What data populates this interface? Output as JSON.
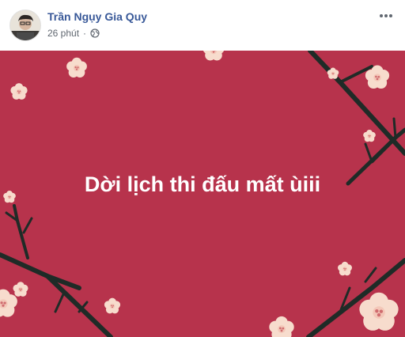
{
  "post": {
    "author": "Trần Ngụy Gia Quy",
    "timestamp": "26 phút",
    "separator": "·",
    "privacy_icon": "globe-icon",
    "more_icon": "more-options-icon",
    "image_text": "Dời lịch thi đấu mất ùiii",
    "colors": {
      "background": "#b7334c",
      "author": "#385898",
      "branch": "#1f2b27",
      "blossom": "#f7dccd",
      "blossom_center": "#d06c6f"
    }
  }
}
